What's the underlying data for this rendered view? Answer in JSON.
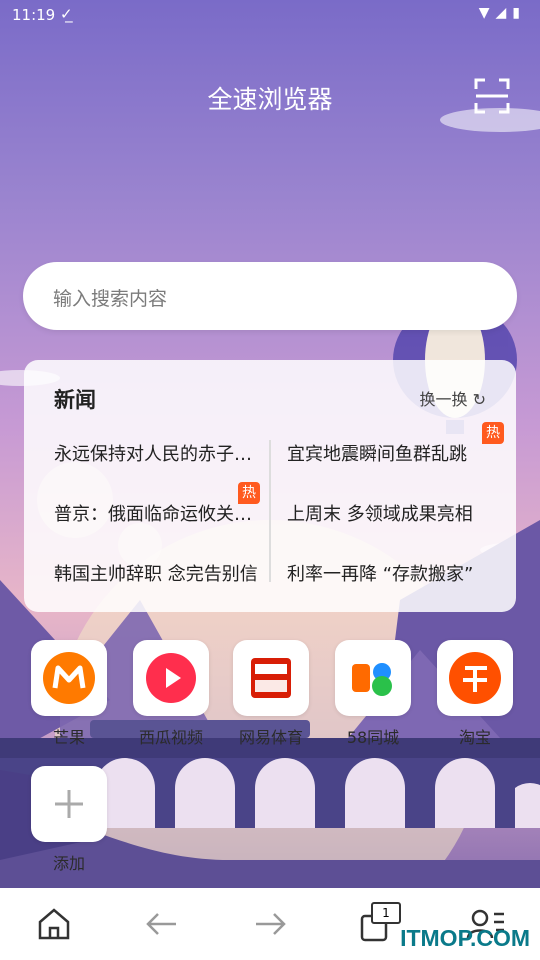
{
  "status_bar": {
    "time": "11:19",
    "download_icon": "download-done-icon",
    "wifi_icon": "wifi-icon",
    "signal_icon": "signal-icon",
    "battery_icon": "battery-icon"
  },
  "header": {
    "title": "全速浏览器",
    "scan_icon": "scan-icon"
  },
  "search": {
    "placeholder": "输入搜索内容"
  },
  "news": {
    "title": "新闻",
    "refresh_label": "换一换 ↻",
    "left": [
      "永远保持对人民的赤子之心",
      "普京：俄面临命运攸关时刻",
      "韩国主帅辞职 念完告别信"
    ],
    "right": [
      "宜宾地震瞬间鱼群乱跳",
      "上周末 多领域成果亮相",
      "利率一再降 “存款搬家”"
    ],
    "hot_label": "热"
  },
  "apps": [
    {
      "label": "芒果",
      "icon": "mango-tv-icon",
      "color": "#ff7a00"
    },
    {
      "label": "西瓜视频",
      "icon": "xigua-video-icon",
      "color": "#ff2e4d"
    },
    {
      "label": "网易体育",
      "icon": "netease-sports-icon",
      "color": "#d81e06"
    },
    {
      "label": "58同城",
      "icon": "58-tongcheng-icon",
      "color": "#ff6a00"
    },
    {
      "label": "淘宝",
      "icon": "taobao-icon",
      "color": "#ff5000"
    }
  ],
  "add_app": {
    "label": "添加"
  },
  "bottom_nav": {
    "tab_count": "1"
  },
  "watermark": "ITMOP.COM"
}
